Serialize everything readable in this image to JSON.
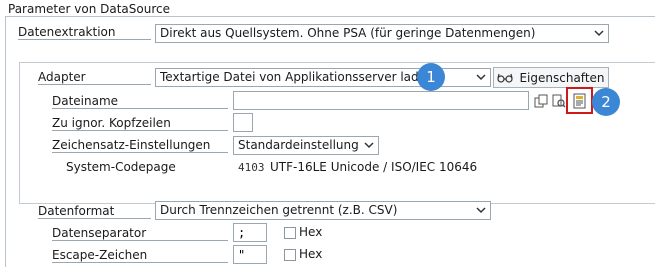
{
  "panel": {
    "title": "Parameter von DataSource"
  },
  "datenextraktion": {
    "label": "Datenextraktion",
    "value": "Direkt aus Quellsystem. Ohne PSA (für geringe Datenmengen)"
  },
  "adapter": {
    "label": "Adapter",
    "value": "Textartige Datei von Applikationsserver laden",
    "properties_button": "Eigenschaften"
  },
  "dateiname": {
    "label": "Dateiname",
    "value": ""
  },
  "kopfzeilen": {
    "label": "Zu ignor. Kopfzeilen",
    "value": ""
  },
  "zeichensatz": {
    "label": "Zeichensatz-Einstellungen",
    "value": "Standardeinstellung"
  },
  "codepage": {
    "label": "System-Codepage",
    "code": "4103",
    "description": "UTF-16LE Unicode / ISO/IEC 10646"
  },
  "datenformat": {
    "label": "Datenformat",
    "value": "Durch Trennzeichen getrennt (z.B. CSV)"
  },
  "separator": {
    "label": "Datenseparator",
    "value": ";",
    "hex_label": "Hex"
  },
  "escape": {
    "label": "Escape-Zeichen",
    "value": "\"",
    "hex_label": "Hex"
  },
  "callouts": {
    "one": "1",
    "two": "2"
  },
  "colors": {
    "callout": "#3b87d6",
    "highlight": "#d01818"
  },
  "icons": [
    "chevron-down-icon",
    "glasses-icon",
    "copy-icon",
    "search-icon",
    "file-browse-icon"
  ]
}
